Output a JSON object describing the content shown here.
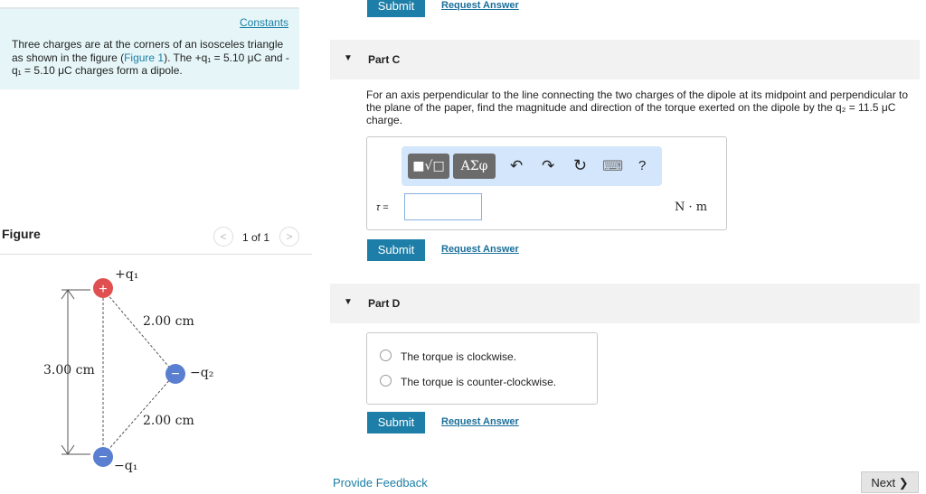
{
  "intro": {
    "constants_link": "Constants",
    "text_before": "Three charges are at the corners of an isosceles triangle as shown in the figure (",
    "figure_link": "Figure 1",
    "text_after": "). The +q₁ = 5.10 μC and -q₁ = 5.10 μC charges form a dipole."
  },
  "figure": {
    "title": "Figure",
    "pager": "1 of 1",
    "labels": {
      "q1_plus": "+q₁",
      "q2": "−q₂",
      "q1_minus": "−q₁",
      "side_top": "2.00 cm",
      "side_bottom": "2.00 cm",
      "height": "3.00 cm"
    }
  },
  "top": {
    "submit": "Submit",
    "request": "Request Answer"
  },
  "partC": {
    "title": "Part C",
    "question": "For an axis perpendicular to the line connecting the two charges of the dipole at its midpoint and perpendicular to the plane of the paper, find the magnitude and direction of the torque exerted on the dipole by the q₂ = 11.5 μC charge.",
    "toolbar": {
      "templates": "■√□",
      "greek": "ΑΣφ",
      "undo": "↶",
      "redo": "↷",
      "reset": "↻",
      "keyboard": "⌨",
      "help": "?"
    },
    "label": "τ =",
    "value": "",
    "unit": "N · m",
    "submit": "Submit",
    "request": "Request Answer"
  },
  "partD": {
    "title": "Part D",
    "options": [
      "The torque is clockwise.",
      "The torque is counter-clockwise."
    ],
    "submit": "Submit",
    "request": "Request Answer"
  },
  "footer": {
    "feedback": "Provide Feedback",
    "next": "Next ❯"
  }
}
